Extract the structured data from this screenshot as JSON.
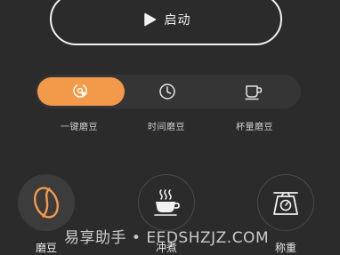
{
  "start_button": {
    "label": "启动",
    "icon": "play-icon"
  },
  "modes": [
    {
      "label": "一键磨豆",
      "icon": "one-touch-icon",
      "active": true
    },
    {
      "label": "时间磨豆",
      "icon": "clock-icon",
      "active": false
    },
    {
      "label": "杯量磨豆",
      "icon": "cup-icon",
      "active": false
    }
  ],
  "functions": [
    {
      "label": "磨豆",
      "icon": "coffee-bean-icon",
      "selected": true
    },
    {
      "label": "冲煮",
      "icon": "steaming-cup-icon",
      "selected": false
    },
    {
      "label": "称重",
      "icon": "scale-icon",
      "selected": false
    }
  ],
  "watermark": "易享助手 • EEDSHZJZ.COM",
  "colors": {
    "background": "#2b2b2c",
    "accent": "#f39a4a",
    "mode_bar": "#353536",
    "text": "#eaeaea"
  }
}
